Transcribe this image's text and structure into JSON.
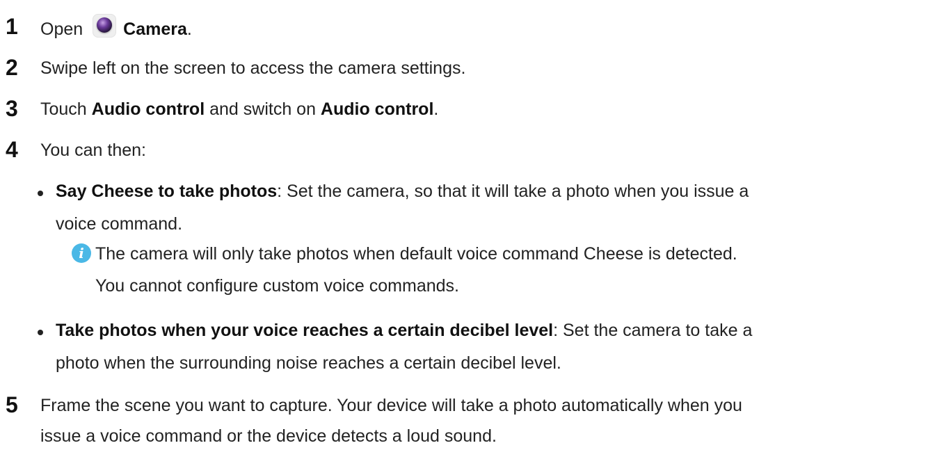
{
  "steps": [
    {
      "number": "1",
      "before": "Open",
      "icon": "camera-app-icon",
      "bold": "Camera",
      "after": "."
    },
    {
      "number": "2",
      "text": "Swipe left on the screen to access the camera settings."
    },
    {
      "number": "3",
      "before": "Touch ",
      "bold1": "Audio control",
      "middle": " and switch on ",
      "bold2": "Audio control",
      "after": "."
    },
    {
      "number": "4",
      "text": "You can then:",
      "bullets": [
        {
          "bold": "Say Cheese to take photos",
          "text_line1": ": Set the camera, so that it will take a photo when you issue a",
          "text_line2": "voice command.",
          "note_icon": "info-icon",
          "note_line1": "The camera will only take photos when default voice command Cheese is detected.",
          "note_line2": "You cannot configure custom voice commands."
        },
        {
          "bold": "Take photos when your voice reaches a certain decibel level",
          "text_line1": ": Set the camera to take a",
          "text_line2": "photo when the surrounding noise reaches a certain decibel level."
        }
      ]
    },
    {
      "number": "5",
      "line1": "Frame the scene you want to capture. Your device will take a photo automatically when you",
      "line2": "issue a voice command or the device detects a loud sound."
    }
  ]
}
